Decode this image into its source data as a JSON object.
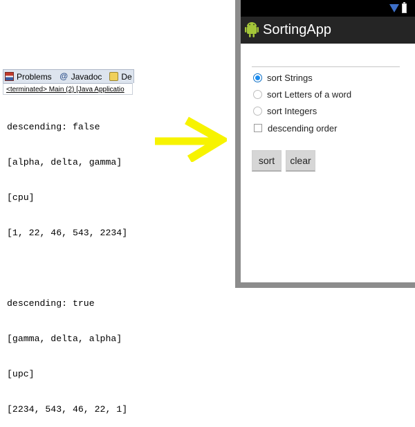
{
  "eclipse": {
    "tabs": [
      {
        "label": "Problems",
        "icon": "problems-icon"
      },
      {
        "label": "Javadoc",
        "icon": "javadoc-icon"
      },
      {
        "label": "De",
        "icon": "declaration-icon"
      }
    ],
    "terminated_label": "<terminated> Main (2) [Java Applicatio",
    "console_lines": [
      "descending: false",
      "[alpha, delta, gamma]",
      "[cpu]",
      "[1, 22, 46, 543, 2234]",
      "",
      "descending: true",
      "[gamma, delta, alpha]",
      "[upc]",
      "[2234, 543, 46, 22, 1]"
    ]
  },
  "arrow": {
    "color": "#f7f300",
    "icon": "right-arrow-icon"
  },
  "phone": {
    "app_title": "SortingApp",
    "input_value": "",
    "options": [
      {
        "label": "sort Strings",
        "checked": true
      },
      {
        "label": "sort Letters of a word",
        "checked": false
      },
      {
        "label": "sort Integers",
        "checked": false
      }
    ],
    "descending_label": "descending order",
    "descending_checked": false,
    "sort_button": "sort",
    "clear_button": "clear",
    "colors": {
      "action_bar": "#252525",
      "status_bar": "#000000",
      "radio_accent": "#1a8cf0",
      "android_green": "#a4c639"
    }
  }
}
